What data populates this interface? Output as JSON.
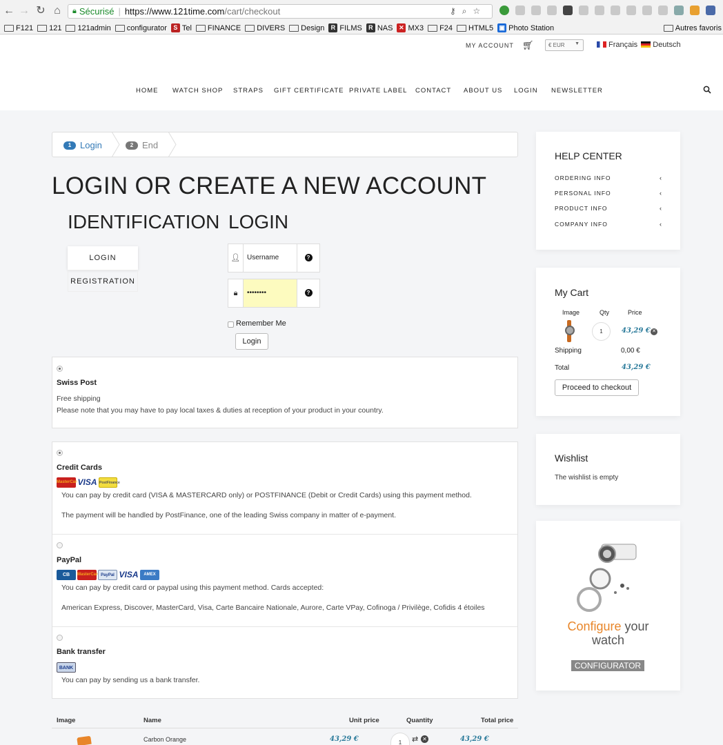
{
  "browser": {
    "secure_label": "Sécurisé",
    "url_host": "https://www.121time.com",
    "url_path": "/cart/checkout",
    "bookmarks": [
      "F121",
      "121",
      "121admin",
      "configurator",
      "Tel",
      "FINANCE",
      "DIVERS",
      "Design",
      "FILMS",
      "NAS",
      "MX3",
      "F24",
      "HTML5",
      "Photo Station",
      "Autres favoris"
    ]
  },
  "topbar": {
    "my_account": "MY ACCOUNT",
    "currency": "€ EUR",
    "lang_fr": "Français",
    "lang_de": "Deutsch"
  },
  "nav": [
    "HOME",
    "WATCH SHOP",
    "STRAPS",
    "GIFT CERTIFICATE",
    "PRIVATE LABEL",
    "CONTACT",
    "ABOUT US",
    "LOGIN",
    "NEWSLETTER"
  ],
  "steps": [
    {
      "num": "1",
      "label": "Login"
    },
    {
      "num": "2",
      "label": "End"
    }
  ],
  "page_title": "LOGIN OR CREATE A NEW ACCOUNT",
  "identification_title": "IDENTIFICATION",
  "login_title": "LOGIN",
  "tabs": {
    "login": "LOGIN",
    "registration": "REGISTRATION"
  },
  "form": {
    "username_placeholder": "Username",
    "password_value": "••••••••",
    "remember_me": "Remember Me",
    "login_button": "Login"
  },
  "shipping": {
    "title": "Swiss Post",
    "line1": "Free shipping",
    "line2": "Please note that you may have to pay local taxes & duties at reception of your product in your country."
  },
  "payments": [
    {
      "title": "Credit Cards",
      "cards": [
        "MasterCard",
        "VISA",
        "PostFinance"
      ],
      "line1": "You can pay by credit card (VISA & MASTERCARD only) or POSTFINANCE (Debit or Credit Cards) using this payment method.",
      "line2": "The payment will be handled by PostFinance, one of the leading Swiss company in matter of e-payment."
    },
    {
      "title": "PayPal",
      "cards": [
        "CB",
        "MasterCard",
        "PayPal",
        "VISA",
        "AMEX"
      ],
      "line1": "You can pay by credit card or paypal using this payment method. Cards accepted:",
      "line2": "American Express, Discover, MasterCard, Visa, Carte Bancaire Nationale, Aurore, Carte VPay, Cofinoga / Privilège, Cofidis 4 étoiles"
    },
    {
      "title": "Bank transfer",
      "cards": [
        "BANK"
      ],
      "line1": "You can pay by sending us a bank transfer."
    }
  ],
  "table": {
    "headers": [
      "Image",
      "Name",
      "Unit price",
      "Quantity",
      "Total price"
    ],
    "rows": [
      {
        "name": "Carbon Orange",
        "unit_price": "43,29 €",
        "qty": "1",
        "total": "43,29 €"
      }
    ]
  },
  "help_center": {
    "title": "HELP CENTER",
    "items": [
      "ORDERING INFO",
      "PERSONAL INFO",
      "PRODUCT INFO",
      "COMPANY INFO"
    ]
  },
  "cart": {
    "title": "My Cart",
    "col_image": "Image",
    "col_qty": "Qty",
    "col_price": "Price",
    "qty": "1",
    "price": "43,29 €",
    "shipping_label": "Shipping",
    "shipping_value": "0,00 €",
    "total_label": "Total",
    "total_value": "43,29 €",
    "checkout_button": "Proceed to checkout"
  },
  "wishlist": {
    "title": "Wishlist",
    "text": "The wishlist is empty"
  },
  "configurator": {
    "word1": "Configure",
    "word2": "your",
    "word3": "watch",
    "button": "CONFIGURATOR"
  },
  "colors": {
    "accent_blue": "#337ab7",
    "price_blue": "#2a7a9a",
    "configure_orange": "#e8862a"
  }
}
